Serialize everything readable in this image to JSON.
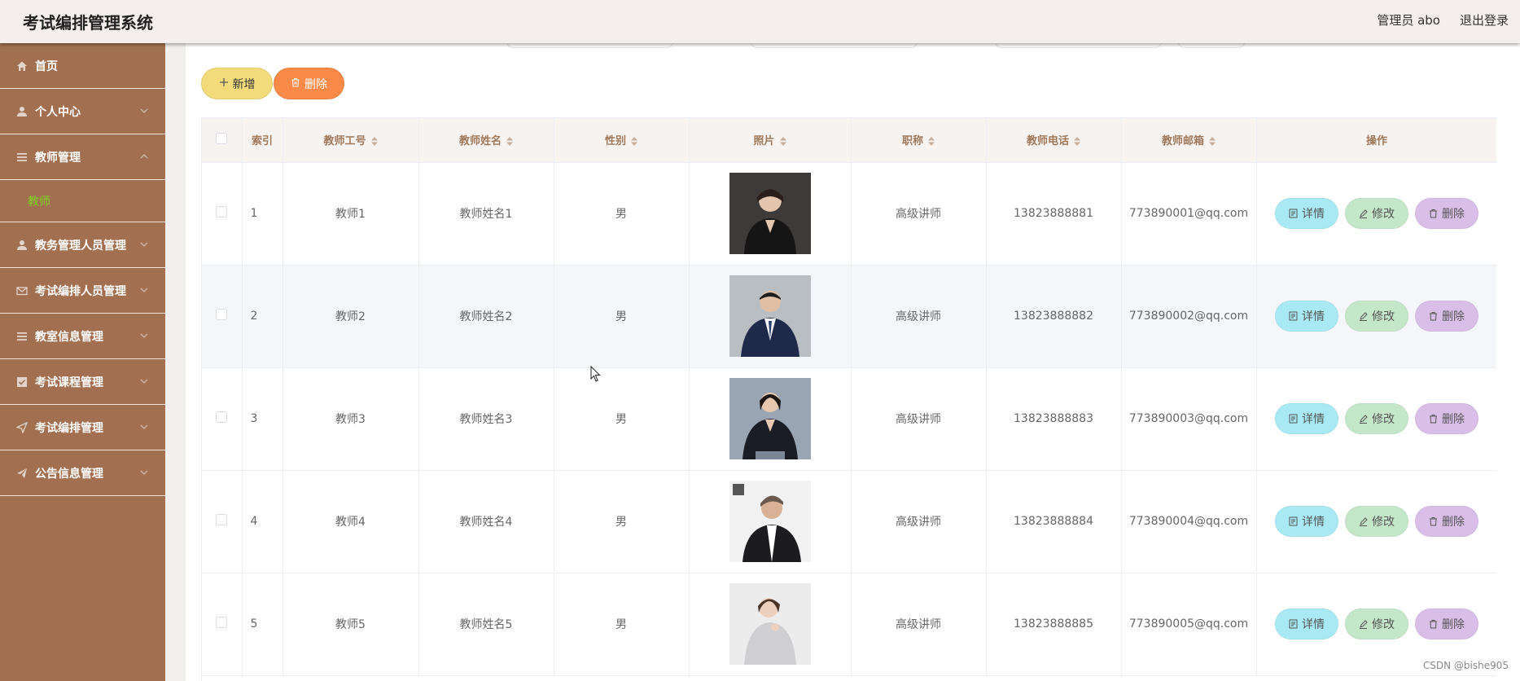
{
  "header": {
    "title": "考试编排管理系统",
    "user_label": "管理员 abo",
    "logout_label": "退出登录"
  },
  "sidebar": {
    "items": [
      {
        "label": "首页",
        "icon": "home-icon"
      },
      {
        "label": "个人中心",
        "icon": "user-icon"
      },
      {
        "label": "教师管理",
        "icon": "list-icon",
        "expanded": true,
        "sub": "教师"
      },
      {
        "label": "教务管理人员管理",
        "icon": "user-icon"
      },
      {
        "label": "考试编排人员管理",
        "icon": "mail-icon"
      },
      {
        "label": "教室信息管理",
        "icon": "list-icon"
      },
      {
        "label": "考试课程管理",
        "icon": "checkbox-icon"
      },
      {
        "label": "考试编排管理",
        "icon": "send-icon"
      },
      {
        "label": "公告信息管理",
        "icon": "plane-icon"
      }
    ]
  },
  "toolbar": {
    "add_label": "新增",
    "delete_label": "删除"
  },
  "table": {
    "columns": [
      "索引",
      "教师工号",
      "教师姓名",
      "性别",
      "照片",
      "职称",
      "教师电话",
      "教师邮箱",
      "操作"
    ],
    "rows": [
      {
        "index": "1",
        "id": "教师1",
        "name": "教师姓名1",
        "gender": "男",
        "title": "高级讲师",
        "phone": "13823888881",
        "email": "773890001@qq.com"
      },
      {
        "index": "2",
        "id": "教师2",
        "name": "教师姓名2",
        "gender": "男",
        "title": "高级讲师",
        "phone": "13823888882",
        "email": "773890002@qq.com"
      },
      {
        "index": "3",
        "id": "教师3",
        "name": "教师姓名3",
        "gender": "男",
        "title": "高级讲师",
        "phone": "13823888883",
        "email": "773890003@qq.com"
      },
      {
        "index": "4",
        "id": "教师4",
        "name": "教师姓名4",
        "gender": "男",
        "title": "高级讲师",
        "phone": "13823888884",
        "email": "773890004@qq.com"
      },
      {
        "index": "5",
        "id": "教师5",
        "name": "教师姓名5",
        "gender": "男",
        "title": "高级讲师",
        "phone": "13823888885",
        "email": "773890005@qq.com"
      }
    ],
    "actions": {
      "detail": "详情",
      "edit": "修改",
      "remove": "删除"
    }
  },
  "watermark": "CSDN @bishe905"
}
